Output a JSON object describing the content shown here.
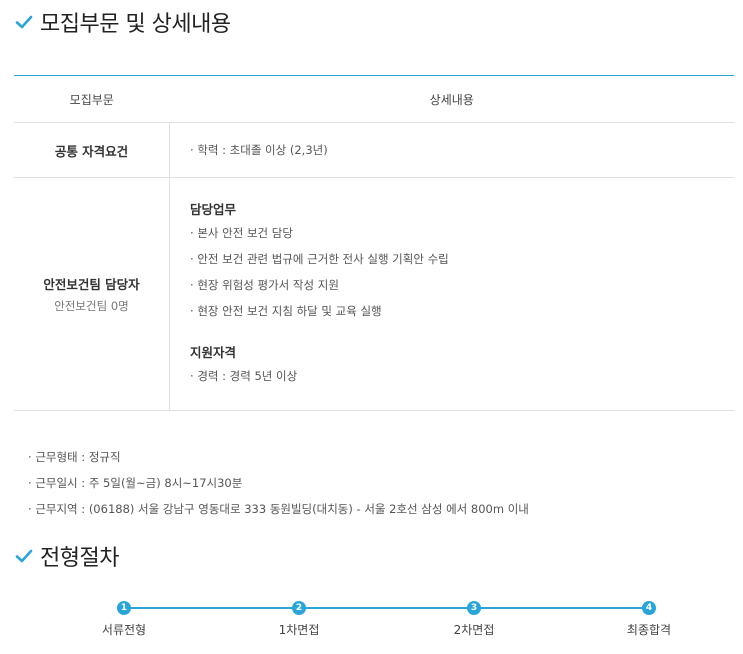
{
  "section1": {
    "title": "모집부문 및 상세내용"
  },
  "table": {
    "headers": {
      "category": "모집부문",
      "details": "상세내용"
    },
    "common": {
      "label": "공통 자격요건",
      "items": [
        "학력 : 초대졸 이상 (2,3년)"
      ]
    },
    "position": {
      "title": "안전보건팀 담당자",
      "sub": "안전보건팀 0명",
      "duties_heading": "담당업무",
      "duties": [
        "본사 안전 보건 담당",
        "안전 보건 관련 법규에 근거한 전사 실행 기획안 수립",
        "현장 위험성 평가서 작성 지원",
        "현장 안전 보건 지침 하달 및 교육 실행"
      ],
      "qual_heading": "지원자격",
      "quals": [
        "경력 : 경력 5년 이상"
      ]
    }
  },
  "conditions": [
    "근무형태 : 정규직",
    "근무일시 : 주 5일(월~금) 8시~17시30분",
    "근무지역 : (06188) 서울 강남구 영동대로 333 동원빌딩(대치동) - 서울 2호선 삼성 에서 800m 이내"
  ],
  "section2": {
    "title": "전형절차"
  },
  "process": [
    {
      "num": "1",
      "label": "서류전형"
    },
    {
      "num": "2",
      "label": "1차면접"
    },
    {
      "num": "3",
      "label": "2차면접"
    },
    {
      "num": "4",
      "label": "최종합격"
    }
  ],
  "colors": {
    "accent": "#2aa5d9"
  },
  "icons": {
    "section_marker": "check-icon"
  }
}
